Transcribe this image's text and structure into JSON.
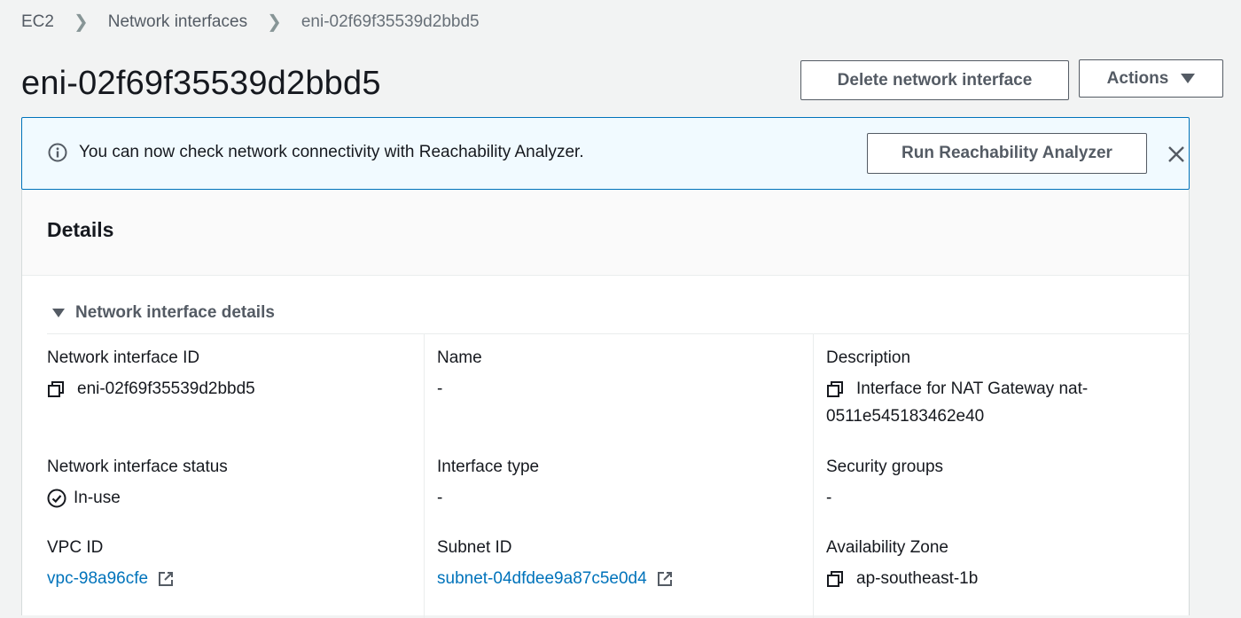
{
  "breadcrumb": {
    "items": [
      "EC2",
      "Network interfaces",
      "eni-02f69f35539d2bbd5"
    ]
  },
  "header": {
    "title": "eni-02f69f35539d2bbd5",
    "delete_label": "Delete network interface",
    "actions_label": "Actions"
  },
  "flash": {
    "message": "You can now check network connectivity with Reachability Analyzer.",
    "run_label": "Run Reachability Analyzer"
  },
  "details": {
    "title": "Details",
    "section_label": "Network interface details",
    "fields": {
      "eni_id": {
        "label": "Network interface ID",
        "value": "eni-02f69f35539d2bbd5"
      },
      "name": {
        "label": "Name",
        "value": "-"
      },
      "description": {
        "label": "Description",
        "value_line1": "Interface for NAT Gateway nat-",
        "value_line2": "0511e545183462e40"
      },
      "status": {
        "label": "Network interface status",
        "value": "In-use"
      },
      "interface_type": {
        "label": "Interface type",
        "value": "-"
      },
      "security_groups": {
        "label": "Security groups",
        "value": "-"
      },
      "vpc_id": {
        "label": "VPC ID",
        "value": "vpc-98a96cfe"
      },
      "subnet_id": {
        "label": "Subnet ID",
        "value": "subnet-04dfdee9a87c5e0d4"
      },
      "az": {
        "label": "Availability Zone",
        "value": "ap-southeast-1b"
      }
    }
  },
  "colors": {
    "link": "#0073bb",
    "info_border": "#0073bb",
    "info_bg": "#f1faff",
    "page_bg": "#f2f3f3",
    "button_text": "#545b64"
  },
  "icons": [
    "info-icon",
    "close-icon",
    "copy-icon",
    "status-ok-icon",
    "external-link-icon",
    "caret-down-icon",
    "expand-triangle-icon"
  ]
}
